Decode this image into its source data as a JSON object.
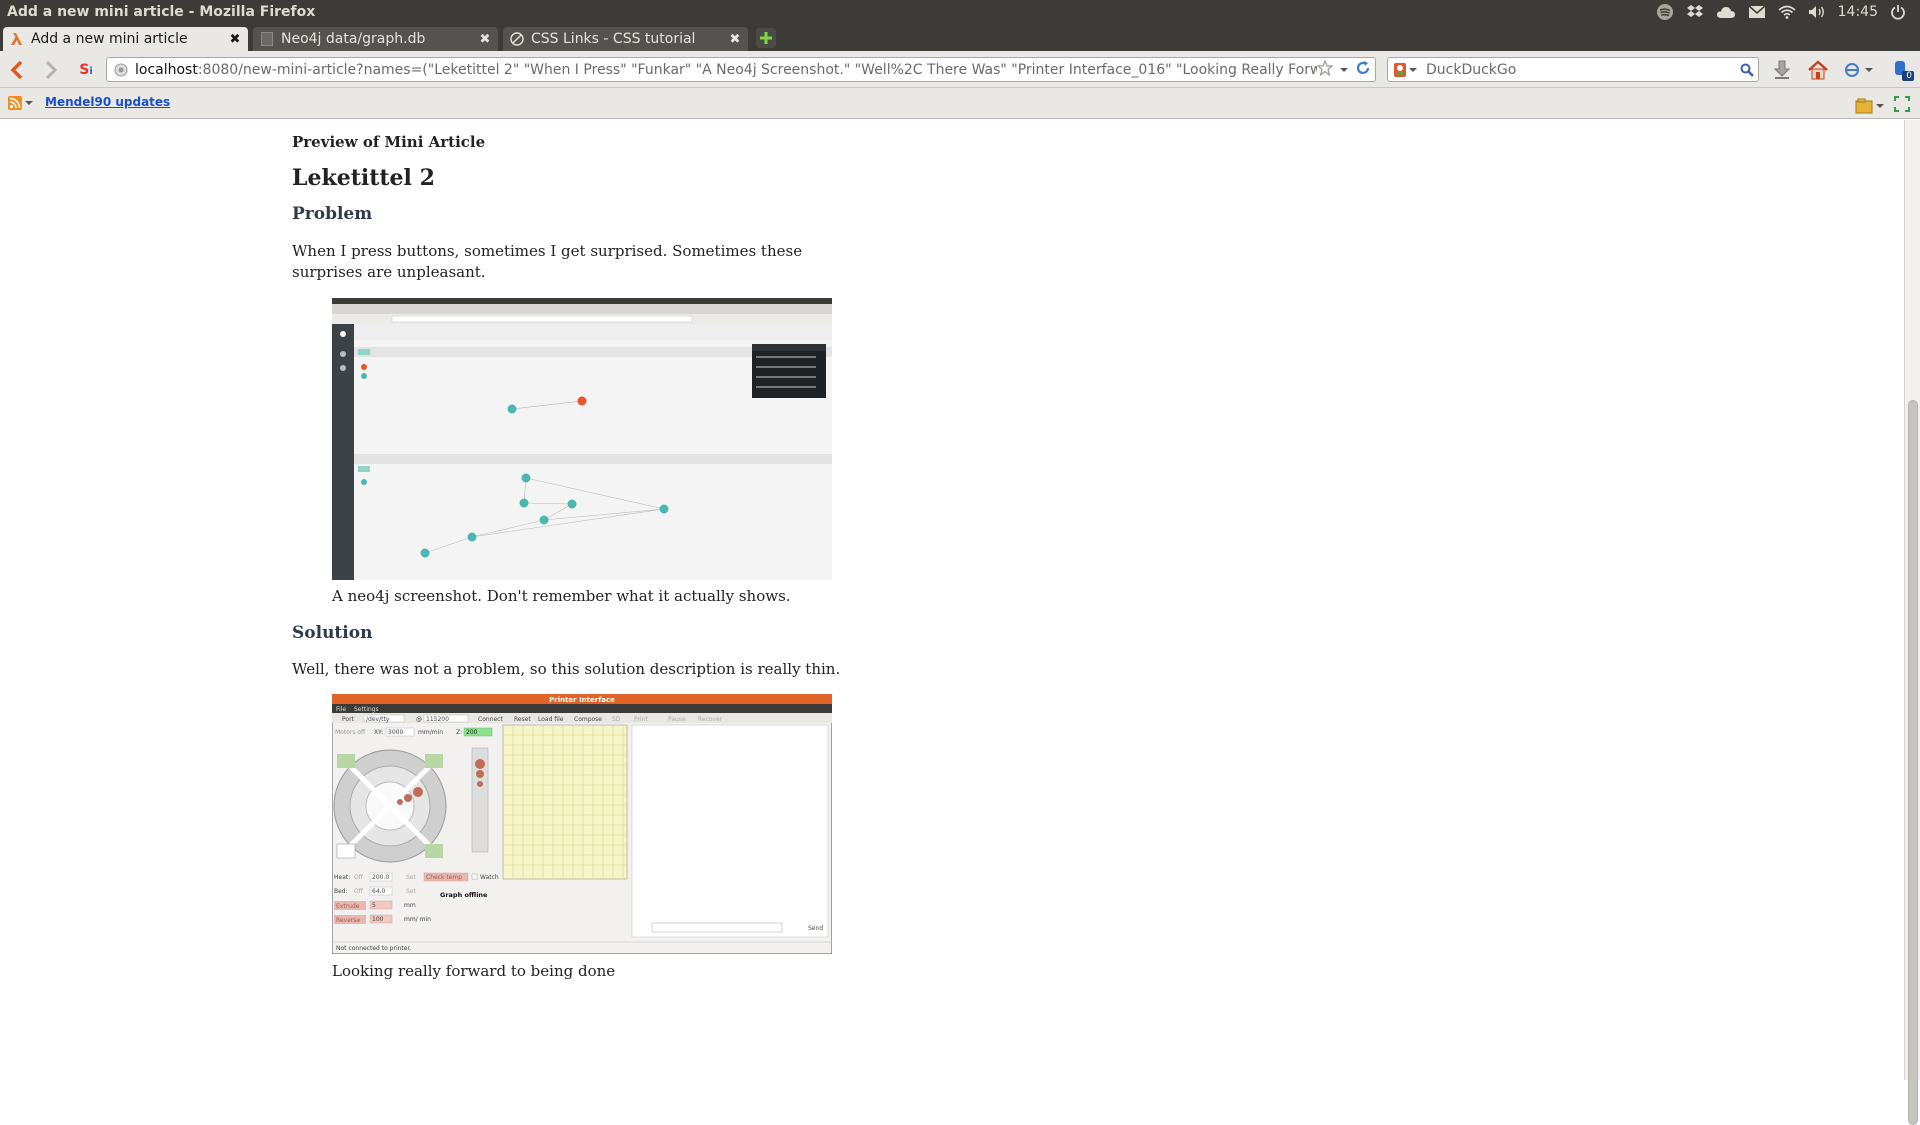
{
  "window": {
    "title": "Add a new mini article - Mozilla Firefox"
  },
  "panel": {
    "clock": "14:45"
  },
  "tabs": [
    {
      "label": "Add a new mini article",
      "active": true
    },
    {
      "label": "Neo4j data/graph.db",
      "active": false
    },
    {
      "label": "CSS Links - CSS tutorial",
      "active": false
    }
  ],
  "navbar": {
    "url_host": "localhost",
    "url_rest": ":8080/new-mini-article?names=(\"Leketittel 2\" \"When I Press\" \"Funkar\" \"A Neo4j Screenshot.\" \"Well%2C There Was\" \"Printer Interface_016\" \"Looking Really Forward\")",
    "search_placeholder": "DuckDuckGo",
    "addon_badge": "0"
  },
  "bookmarks": {
    "items": [
      "Mendel90 updates"
    ]
  },
  "article": {
    "preview_label": "Preview of Mini Article",
    "title": "Leketittel 2",
    "problem_heading": "Problem",
    "problem_text": "When I press buttons, sometimes I get surprised. Sometimes these surprises are unpleasant.",
    "figure1_caption": "A neo4j screenshot. Don't remember what it actually shows.",
    "solution_heading": "Solution",
    "solution_text": "Well, there was not a problem, so this solution description is really thin.",
    "figure2_caption": "Looking really forward to being done"
  },
  "printer": {
    "title": "Printer Interface",
    "menu": [
      "File",
      "Settings"
    ],
    "toolbar": [
      "Port",
      "/dev/tty",
      "@",
      "115200",
      "Connect",
      "Reset",
      "Load file",
      "Compose",
      "SD",
      "Print",
      "Pause",
      "Recover"
    ],
    "motors_off": "Motors off",
    "xy_label": "XY:",
    "xy_value": "3000",
    "mm_min": "mm/min",
    "z_label": "Z:",
    "z_value": "200",
    "heat_label": "Heat:",
    "heat_off": "Off",
    "heat_value": "200.0",
    "set_label": "Set",
    "check_temp": "Check temp",
    "watch_label": "Watch",
    "bed_label": "Bed:",
    "bed_value": "64.0",
    "extrude_label": "Extrude",
    "extrude_value": "5",
    "mm": "mm",
    "reverse_label": "Reverse",
    "reverse_value": "100",
    "mm_min2": "mm/ min",
    "graph_offline": "Graph offline",
    "send": "Send",
    "status": "Not connected to printer."
  },
  "colors": {
    "panel_bg": "#3c3b37",
    "chrome_bg": "#e9e8e4",
    "neo4j_teal": "#4ab8b0",
    "neo4j_orange": "#e8562a",
    "printer_titlebar": "#e0642a",
    "grid_yellow": "#f5f5c8"
  }
}
